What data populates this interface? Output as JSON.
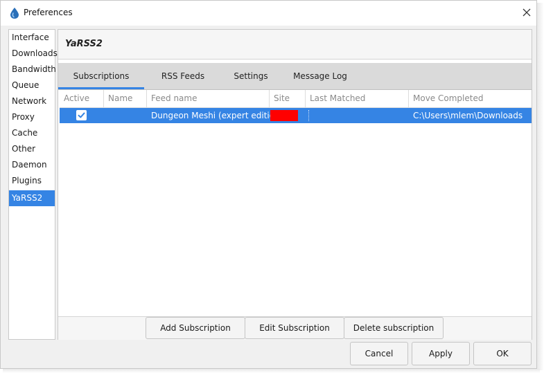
{
  "window": {
    "title": "Preferences",
    "close_icon": "close-icon",
    "app_icon": "deluge-drop-icon"
  },
  "sidebar": {
    "items": [
      {
        "label": "Interface"
      },
      {
        "label": "Downloads"
      },
      {
        "label": "Bandwidth"
      },
      {
        "label": "Queue"
      },
      {
        "label": "Network"
      },
      {
        "label": "Proxy"
      },
      {
        "label": "Cache"
      },
      {
        "label": "Other"
      },
      {
        "label": "Daemon"
      },
      {
        "label": "Plugins"
      },
      {
        "label": "YaRSS2",
        "selected": true
      }
    ]
  },
  "plugin": {
    "title": "YaRSS2",
    "tabs": [
      {
        "label": "Subscriptions",
        "active": true
      },
      {
        "label": "RSS Feeds"
      },
      {
        "label": "Settings"
      },
      {
        "label": "Message Log"
      }
    ],
    "table": {
      "columns": [
        "Active",
        "Name",
        "Feed name",
        "Site",
        "Last Matched",
        "Move Completed"
      ],
      "rows": [
        {
          "active": true,
          "name": "",
          "feed_name": "Dungeon Meshi (expert edition)",
          "site_color": "#ff0000",
          "last_matched": "",
          "move_completed": "C:\\Users\\mlem\\Downloads"
        }
      ]
    },
    "buttons": {
      "add": "Add Subscription",
      "edit": "Edit Subscription",
      "delete": "Delete subscription"
    }
  },
  "dialog_buttons": {
    "cancel": "Cancel",
    "apply": "Apply",
    "ok": "OK"
  },
  "colors": {
    "accent": "#3584e4",
    "site_swatch": "#ff0000"
  }
}
